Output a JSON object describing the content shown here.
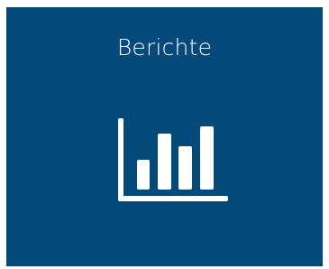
{
  "tile": {
    "label": "Berichte",
    "icon": "bar-chart-icon",
    "background_color": "#03497a",
    "foreground_color": "#ffffff"
  }
}
